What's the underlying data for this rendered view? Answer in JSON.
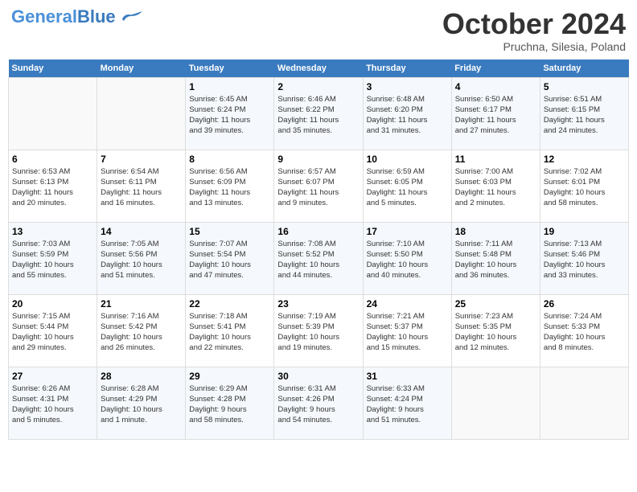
{
  "header": {
    "logo_text1": "General",
    "logo_text2": "Blue",
    "month": "October 2024",
    "location": "Pruchna, Silesia, Poland"
  },
  "weekdays": [
    "Sunday",
    "Monday",
    "Tuesday",
    "Wednesday",
    "Thursday",
    "Friday",
    "Saturday"
  ],
  "weeks": [
    [
      {
        "day": "",
        "info": ""
      },
      {
        "day": "",
        "info": ""
      },
      {
        "day": "1",
        "info": "Sunrise: 6:45 AM\nSunset: 6:24 PM\nDaylight: 11 hours\nand 39 minutes."
      },
      {
        "day": "2",
        "info": "Sunrise: 6:46 AM\nSunset: 6:22 PM\nDaylight: 11 hours\nand 35 minutes."
      },
      {
        "day": "3",
        "info": "Sunrise: 6:48 AM\nSunset: 6:20 PM\nDaylight: 11 hours\nand 31 minutes."
      },
      {
        "day": "4",
        "info": "Sunrise: 6:50 AM\nSunset: 6:17 PM\nDaylight: 11 hours\nand 27 minutes."
      },
      {
        "day": "5",
        "info": "Sunrise: 6:51 AM\nSunset: 6:15 PM\nDaylight: 11 hours\nand 24 minutes."
      }
    ],
    [
      {
        "day": "6",
        "info": "Sunrise: 6:53 AM\nSunset: 6:13 PM\nDaylight: 11 hours\nand 20 minutes."
      },
      {
        "day": "7",
        "info": "Sunrise: 6:54 AM\nSunset: 6:11 PM\nDaylight: 11 hours\nand 16 minutes."
      },
      {
        "day": "8",
        "info": "Sunrise: 6:56 AM\nSunset: 6:09 PM\nDaylight: 11 hours\nand 13 minutes."
      },
      {
        "day": "9",
        "info": "Sunrise: 6:57 AM\nSunset: 6:07 PM\nDaylight: 11 hours\nand 9 minutes."
      },
      {
        "day": "10",
        "info": "Sunrise: 6:59 AM\nSunset: 6:05 PM\nDaylight: 11 hours\nand 5 minutes."
      },
      {
        "day": "11",
        "info": "Sunrise: 7:00 AM\nSunset: 6:03 PM\nDaylight: 11 hours\nand 2 minutes."
      },
      {
        "day": "12",
        "info": "Sunrise: 7:02 AM\nSunset: 6:01 PM\nDaylight: 10 hours\nand 58 minutes."
      }
    ],
    [
      {
        "day": "13",
        "info": "Sunrise: 7:03 AM\nSunset: 5:59 PM\nDaylight: 10 hours\nand 55 minutes."
      },
      {
        "day": "14",
        "info": "Sunrise: 7:05 AM\nSunset: 5:56 PM\nDaylight: 10 hours\nand 51 minutes."
      },
      {
        "day": "15",
        "info": "Sunrise: 7:07 AM\nSunset: 5:54 PM\nDaylight: 10 hours\nand 47 minutes."
      },
      {
        "day": "16",
        "info": "Sunrise: 7:08 AM\nSunset: 5:52 PM\nDaylight: 10 hours\nand 44 minutes."
      },
      {
        "day": "17",
        "info": "Sunrise: 7:10 AM\nSunset: 5:50 PM\nDaylight: 10 hours\nand 40 minutes."
      },
      {
        "day": "18",
        "info": "Sunrise: 7:11 AM\nSunset: 5:48 PM\nDaylight: 10 hours\nand 36 minutes."
      },
      {
        "day": "19",
        "info": "Sunrise: 7:13 AM\nSunset: 5:46 PM\nDaylight: 10 hours\nand 33 minutes."
      }
    ],
    [
      {
        "day": "20",
        "info": "Sunrise: 7:15 AM\nSunset: 5:44 PM\nDaylight: 10 hours\nand 29 minutes."
      },
      {
        "day": "21",
        "info": "Sunrise: 7:16 AM\nSunset: 5:42 PM\nDaylight: 10 hours\nand 26 minutes."
      },
      {
        "day": "22",
        "info": "Sunrise: 7:18 AM\nSunset: 5:41 PM\nDaylight: 10 hours\nand 22 minutes."
      },
      {
        "day": "23",
        "info": "Sunrise: 7:19 AM\nSunset: 5:39 PM\nDaylight: 10 hours\nand 19 minutes."
      },
      {
        "day": "24",
        "info": "Sunrise: 7:21 AM\nSunset: 5:37 PM\nDaylight: 10 hours\nand 15 minutes."
      },
      {
        "day": "25",
        "info": "Sunrise: 7:23 AM\nSunset: 5:35 PM\nDaylight: 10 hours\nand 12 minutes."
      },
      {
        "day": "26",
        "info": "Sunrise: 7:24 AM\nSunset: 5:33 PM\nDaylight: 10 hours\nand 8 minutes."
      }
    ],
    [
      {
        "day": "27",
        "info": "Sunrise: 6:26 AM\nSunset: 4:31 PM\nDaylight: 10 hours\nand 5 minutes."
      },
      {
        "day": "28",
        "info": "Sunrise: 6:28 AM\nSunset: 4:29 PM\nDaylight: 10 hours\nand 1 minute."
      },
      {
        "day": "29",
        "info": "Sunrise: 6:29 AM\nSunset: 4:28 PM\nDaylight: 9 hours\nand 58 minutes."
      },
      {
        "day": "30",
        "info": "Sunrise: 6:31 AM\nSunset: 4:26 PM\nDaylight: 9 hours\nand 54 minutes."
      },
      {
        "day": "31",
        "info": "Sunrise: 6:33 AM\nSunset: 4:24 PM\nDaylight: 9 hours\nand 51 minutes."
      },
      {
        "day": "",
        "info": ""
      },
      {
        "day": "",
        "info": ""
      }
    ]
  ]
}
